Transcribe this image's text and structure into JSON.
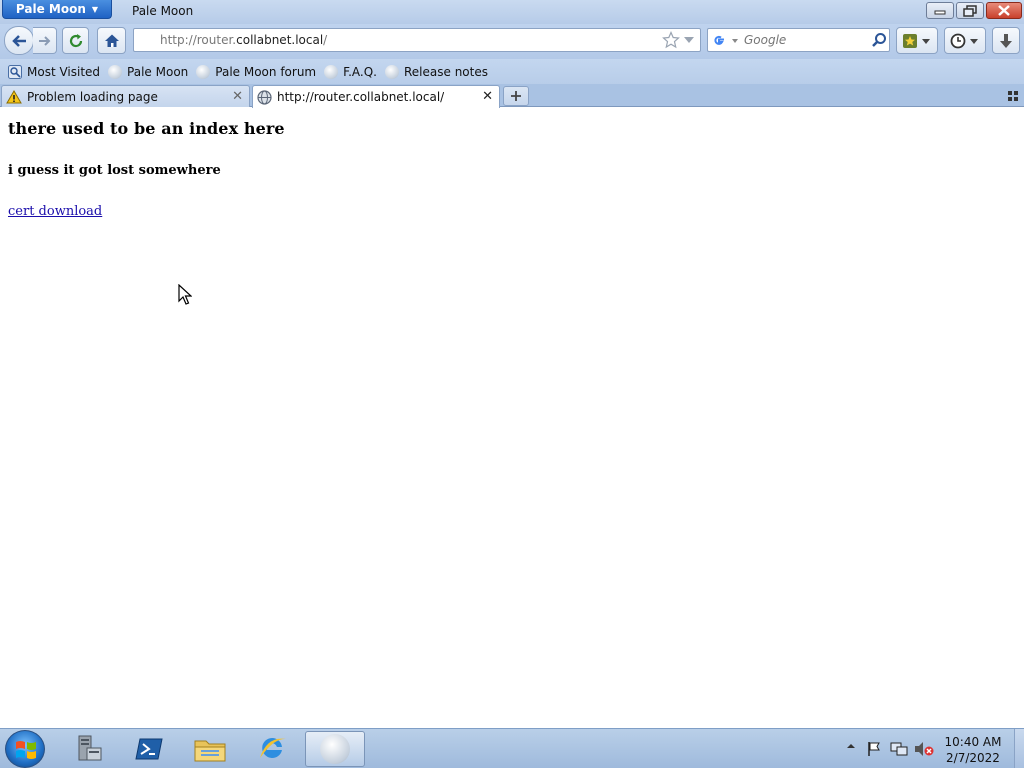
{
  "window": {
    "app_menu_label": "Pale Moon",
    "title": "Pale Moon"
  },
  "navbar": {
    "url_prefix": "http://router.",
    "url_domain": "collabnet.local",
    "url_suffix": "/",
    "search_placeholder": "Google"
  },
  "bookmarks": [
    {
      "label": "Most Visited",
      "icon": "most-visited-icon"
    },
    {
      "label": "Pale Moon",
      "icon": "moon-icon"
    },
    {
      "label": "Pale Moon forum",
      "icon": "moon-icon"
    },
    {
      "label": "F.A.Q.",
      "icon": "moon-icon"
    },
    {
      "label": "Release notes",
      "icon": "moon-icon"
    }
  ],
  "tabs": [
    {
      "label": "Problem loading page",
      "icon": "warning-icon",
      "active": false
    },
    {
      "label": "http://router.collabnet.local/",
      "icon": "globe-icon",
      "active": true
    }
  ],
  "page": {
    "heading": "there used to be an index here",
    "subheading": "i guess it got lost somewhere",
    "link_text": "cert download"
  },
  "taskbar": {
    "time": "10:40 AM",
    "date": "2/7/2022"
  }
}
